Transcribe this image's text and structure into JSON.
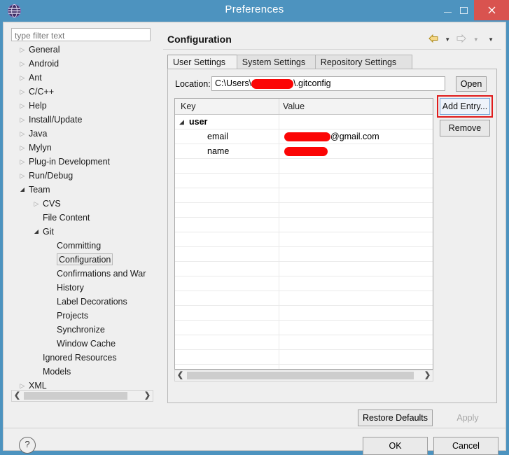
{
  "window": {
    "title": "Preferences",
    "app_icon": "eclipse-icon",
    "minimize_label": "–",
    "maximize_label": "□",
    "close_label": "✕"
  },
  "sidebar": {
    "filter": {
      "placeholder": "type filter text",
      "value": ""
    },
    "items": [
      {
        "label": "General",
        "indent": 0,
        "arrow": "collapsed",
        "selected": false
      },
      {
        "label": "Android",
        "indent": 0,
        "arrow": "collapsed",
        "selected": false
      },
      {
        "label": "Ant",
        "indent": 0,
        "arrow": "collapsed",
        "selected": false
      },
      {
        "label": "C/C++",
        "indent": 0,
        "arrow": "collapsed",
        "selected": false
      },
      {
        "label": "Help",
        "indent": 0,
        "arrow": "collapsed",
        "selected": false
      },
      {
        "label": "Install/Update",
        "indent": 0,
        "arrow": "collapsed",
        "selected": false
      },
      {
        "label": "Java",
        "indent": 0,
        "arrow": "collapsed",
        "selected": false
      },
      {
        "label": "Mylyn",
        "indent": 0,
        "arrow": "collapsed",
        "selected": false
      },
      {
        "label": "Plug-in Development",
        "indent": 0,
        "arrow": "collapsed",
        "selected": false
      },
      {
        "label": "Run/Debug",
        "indent": 0,
        "arrow": "collapsed",
        "selected": false
      },
      {
        "label": "Team",
        "indent": 0,
        "arrow": "expanded",
        "selected": false
      },
      {
        "label": "CVS",
        "indent": 1,
        "arrow": "collapsed",
        "selected": false
      },
      {
        "label": "File Content",
        "indent": 1,
        "arrow": "none",
        "selected": false
      },
      {
        "label": "Git",
        "indent": 1,
        "arrow": "expanded",
        "selected": false
      },
      {
        "label": "Committing",
        "indent": 2,
        "arrow": "none",
        "selected": false
      },
      {
        "label": "Configuration",
        "indent": 2,
        "arrow": "none",
        "selected": true
      },
      {
        "label": "Confirmations and War",
        "indent": 2,
        "arrow": "none",
        "selected": false
      },
      {
        "label": "History",
        "indent": 2,
        "arrow": "none",
        "selected": false
      },
      {
        "label": "Label Decorations",
        "indent": 2,
        "arrow": "none",
        "selected": false
      },
      {
        "label": "Projects",
        "indent": 2,
        "arrow": "none",
        "selected": false
      },
      {
        "label": "Synchronize",
        "indent": 2,
        "arrow": "none",
        "selected": false
      },
      {
        "label": "Window Cache",
        "indent": 2,
        "arrow": "none",
        "selected": false
      },
      {
        "label": "Ignored Resources",
        "indent": 1,
        "arrow": "none",
        "selected": false
      },
      {
        "label": "Models",
        "indent": 1,
        "arrow": "none",
        "selected": false
      },
      {
        "label": "XML",
        "indent": 0,
        "arrow": "collapsed",
        "selected": false
      }
    ],
    "scroll_left_icon": "❮",
    "scroll_right_icon": "❯"
  },
  "page": {
    "title": "Configuration",
    "nav": {
      "back_icon": "back-arrow-icon",
      "back_dropdown_icon": "▼",
      "forward_icon": "forward-arrow-icon",
      "forward_dropdown_icon": "▼",
      "menu_icon": "▼"
    },
    "tabs": [
      {
        "label": "User Settings",
        "active": true
      },
      {
        "label": "System Settings",
        "active": false
      },
      {
        "label": "Repository Settings",
        "active": false
      }
    ],
    "location": {
      "label": "Location:",
      "prefix": "C:\\Users\\",
      "redacted": true,
      "suffix": "\\.gitconfig",
      "open_label": "Open"
    },
    "table": {
      "columns": [
        "Key",
        "Value"
      ],
      "rows": [
        {
          "key": "user",
          "value": "",
          "type": "group",
          "expanded": true,
          "redacted_value": false
        },
        {
          "key": "email",
          "value": "@gmail.com",
          "type": "child",
          "expanded": false,
          "redacted_value": true
        },
        {
          "key": "name",
          "value": "",
          "type": "child",
          "expanded": false,
          "redacted_value": true
        }
      ],
      "empty_rows": 15,
      "scroll_left_icon": "❮",
      "scroll_right_icon": "❯"
    },
    "side_buttons": {
      "add_entry": "Add Entry...",
      "remove": "Remove",
      "highlight_color": "#e01c1c",
      "highlighted": "add-entry-button"
    },
    "footer": {
      "restore_defaults": "Restore Defaults",
      "apply": "Apply",
      "apply_enabled": false
    }
  },
  "dialog_buttons": {
    "help_icon": "?",
    "ok": "OK",
    "cancel": "Cancel"
  }
}
